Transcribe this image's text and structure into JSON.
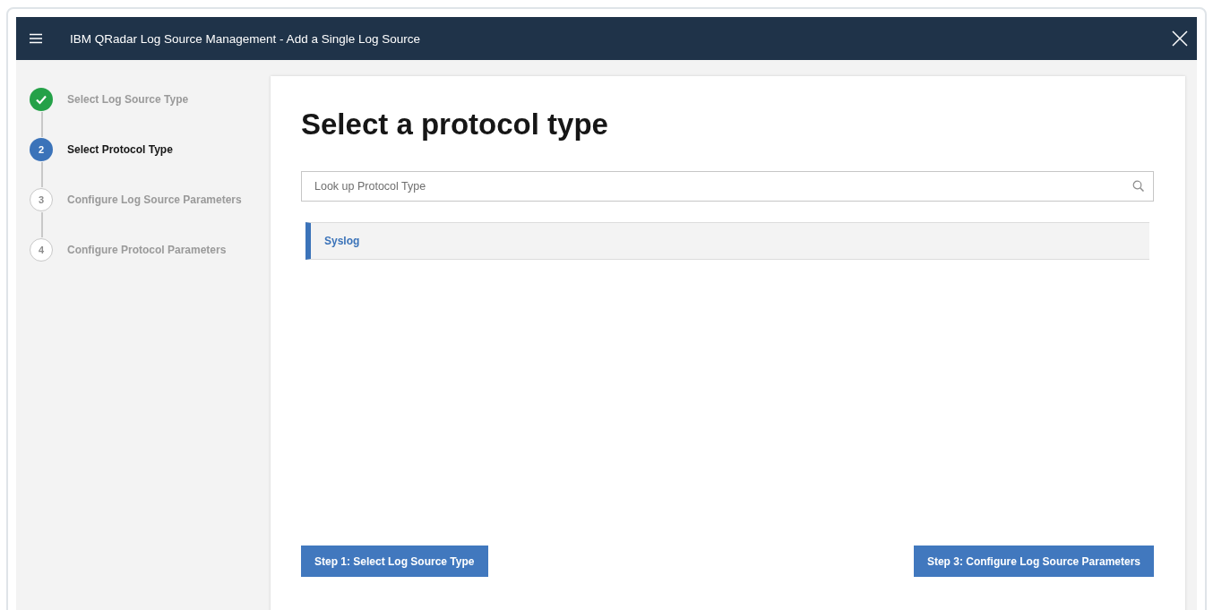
{
  "window": {
    "title": "IBM QRadar Log Source Management - Add a Single Log Source"
  },
  "steps": [
    {
      "label": "Select Log Source Type",
      "kind": "done",
      "selected": false
    },
    {
      "label": "Select Protocol Type",
      "kind": "number",
      "number": "2",
      "selected": true
    },
    {
      "label": "Configure Log Source Parameters",
      "kind": "number",
      "number": "3",
      "selected": false
    },
    {
      "label": "Configure Protocol Parameters",
      "kind": "number",
      "number": "4",
      "selected": false
    }
  ],
  "heading": "Select a protocol type",
  "search": {
    "placeholder": "Look up Protocol Type"
  },
  "protocols": [
    {
      "label": "Syslog",
      "selected": true
    }
  ],
  "buttons": {
    "back": "Step 1: Select Log Source Type",
    "next": "Step 3: Configure Log Source Parameters"
  }
}
